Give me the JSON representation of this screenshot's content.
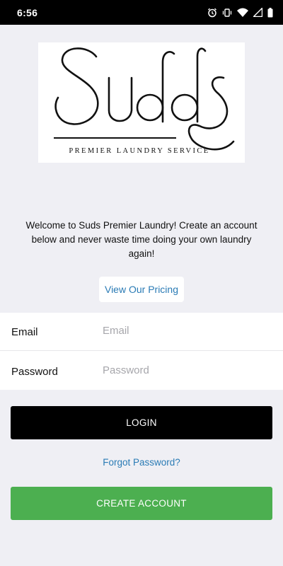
{
  "status_bar": {
    "time": "6:56",
    "icons": [
      "alarm-icon",
      "vibrate-icon",
      "wifi-icon",
      "cellular-signal-icon",
      "battery-icon"
    ]
  },
  "logo": {
    "brand_name": "Suds",
    "tagline": "PREMIER LAUNDRY SERVICE"
  },
  "welcome": {
    "text": "Welcome to Suds Premier Laundry! Create an account below and never waste time doing your own laundry again!"
  },
  "pricing_button": {
    "label": "View Our Pricing"
  },
  "form": {
    "email": {
      "label": "Email",
      "placeholder": "Email",
      "value": ""
    },
    "password": {
      "label": "Password",
      "placeholder": "Password",
      "value": ""
    }
  },
  "actions": {
    "login_label": "LOGIN",
    "forgot_label": "Forgot Password?",
    "create_account_label": "CREATE ACCOUNT"
  },
  "colors": {
    "background": "#efeff4",
    "link": "#2a7bb5",
    "login_button": "#000000",
    "create_button": "#4caf50"
  }
}
